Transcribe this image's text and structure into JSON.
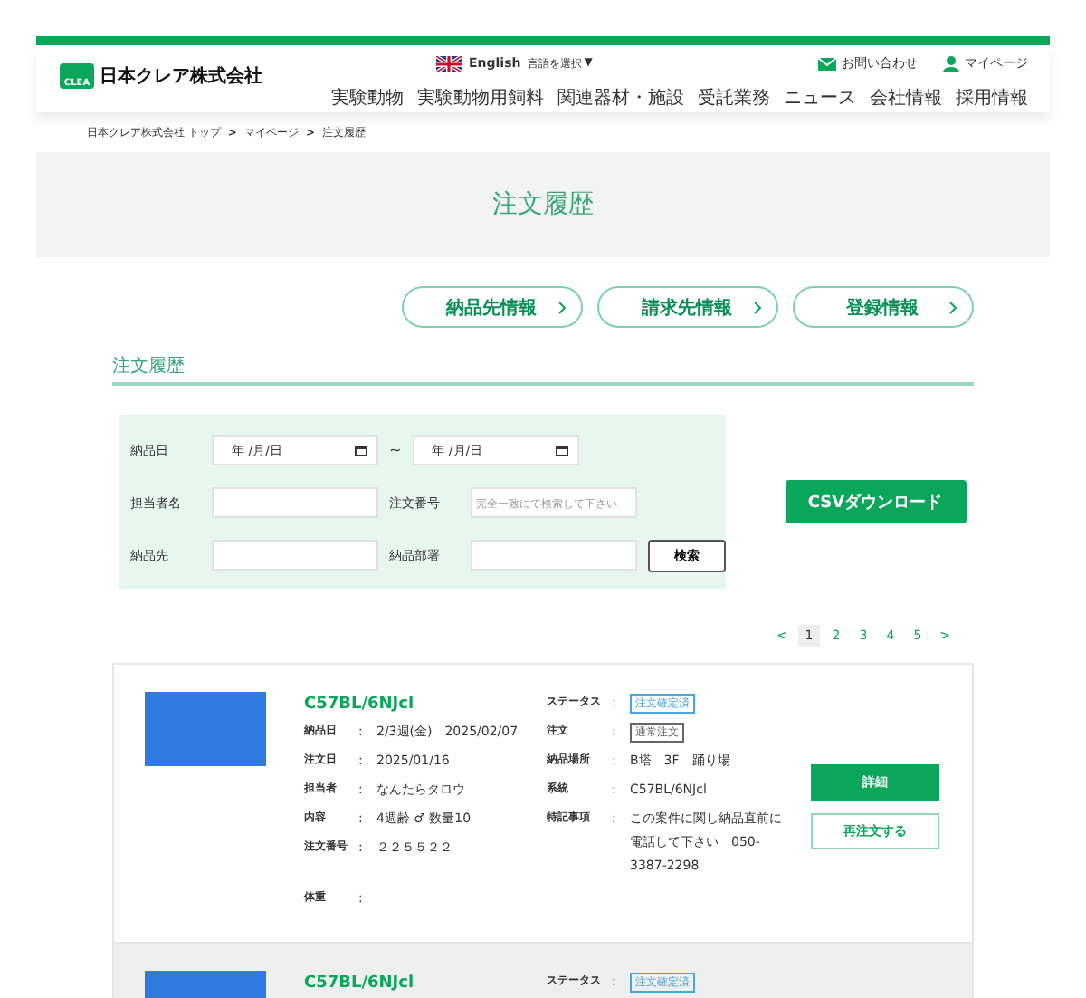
{
  "header": {
    "logo_name": "日本クレア株式会社",
    "logo_mark": "CLEA",
    "language": "English",
    "language_select": "言語を選択",
    "language_caret": "▼",
    "contact": "お問い合わせ",
    "mypage": "マイページ",
    "nav": [
      "実験動物",
      "実験動物用飼料",
      "関連器材・施設",
      "受託業務",
      "ニュース",
      "会社情報",
      "採用情報"
    ]
  },
  "breadcrumb": {
    "separator": ">",
    "items": [
      "日本クレア株式会社 トップ",
      "マイページ",
      "注文履歴"
    ]
  },
  "page_title": "注文履歴",
  "link_buttons": [
    "納品先情報",
    "請求先情報",
    "登録情報"
  ],
  "section_title": "注文履歴",
  "search": {
    "rows": [
      {
        "fields": [
          {
            "label": "納品日",
            "kind": "date",
            "value": "年 /月/日"
          },
          {
            "kind": "range",
            "text": "~"
          },
          {
            "kind": "date",
            "value": "年 /月/日"
          }
        ]
      },
      {
        "fields": [
          {
            "label": "担当者名",
            "kind": "text"
          },
          {
            "label": "注文番号",
            "kind": "text",
            "placeholder": "完全一致にて検索して下さい"
          }
        ]
      },
      {
        "fields": [
          {
            "label": "納品先",
            "kind": "text"
          },
          {
            "label": "納品部署",
            "kind": "text"
          },
          {
            "kind": "button",
            "text": "検索"
          }
        ]
      }
    ]
  },
  "csv_button": "CSVダウンロード",
  "pagination": {
    "prev": "<",
    "next": ">",
    "pages": [
      {
        "label": "1",
        "selected": true
      },
      {
        "label": "2",
        "selected": false
      },
      {
        "label": "3",
        "selected": false
      },
      {
        "label": "4",
        "selected": false
      },
      {
        "label": "5",
        "selected": false
      }
    ]
  },
  "orders": [
    {
      "shaded": false,
      "title": "C57BL/6NJcl",
      "left": [
        {
          "label": "納品日",
          "colon": ":",
          "value": "2/3週(金)　2025/02/07"
        },
        {
          "label": "注文日",
          "colon": ":",
          "value": "2025/01/16"
        },
        {
          "label": "担当者",
          "colon": ":",
          "value": "なんたらタロウ"
        },
        {
          "label": "内容",
          "colon": ":",
          "value": "4週齢 ♂ 数量10"
        },
        {
          "label": "注文番号",
          "colon": ":",
          "value": "２２５５２２"
        },
        {
          "label": "体重",
          "colon": ":"
        }
      ],
      "right": [
        {
          "label": "ステータス",
          "colon": ":",
          "tag": "注文確定済",
          "color": "#4aa6df"
        },
        {
          "label": "注文",
          "colon": ":",
          "tag": "通常注文",
          "color": "#666666"
        },
        {
          "label": "納品場所",
          "colon": ":",
          "value": "B塔　3F　踊り場"
        },
        {
          "label": "系統",
          "colon": ":",
          "value": "C57BL/6NJcl"
        },
        {
          "label": "特記事項",
          "colon": ":",
          "value": "この案件に関し納品直前に電話して下さい　050-3387-2298"
        }
      ],
      "buttons": [
        {
          "kind": "primary",
          "text": "詳細"
        },
        {
          "kind": "outline",
          "text": "再注文する"
        }
      ]
    },
    {
      "shaded": true,
      "title": "C57BL/6NJcl",
      "right": [
        {
          "label": "ステータス",
          "colon": ":",
          "tag": "注文確定済",
          "color": "#4aa6df"
        }
      ]
    }
  ]
}
